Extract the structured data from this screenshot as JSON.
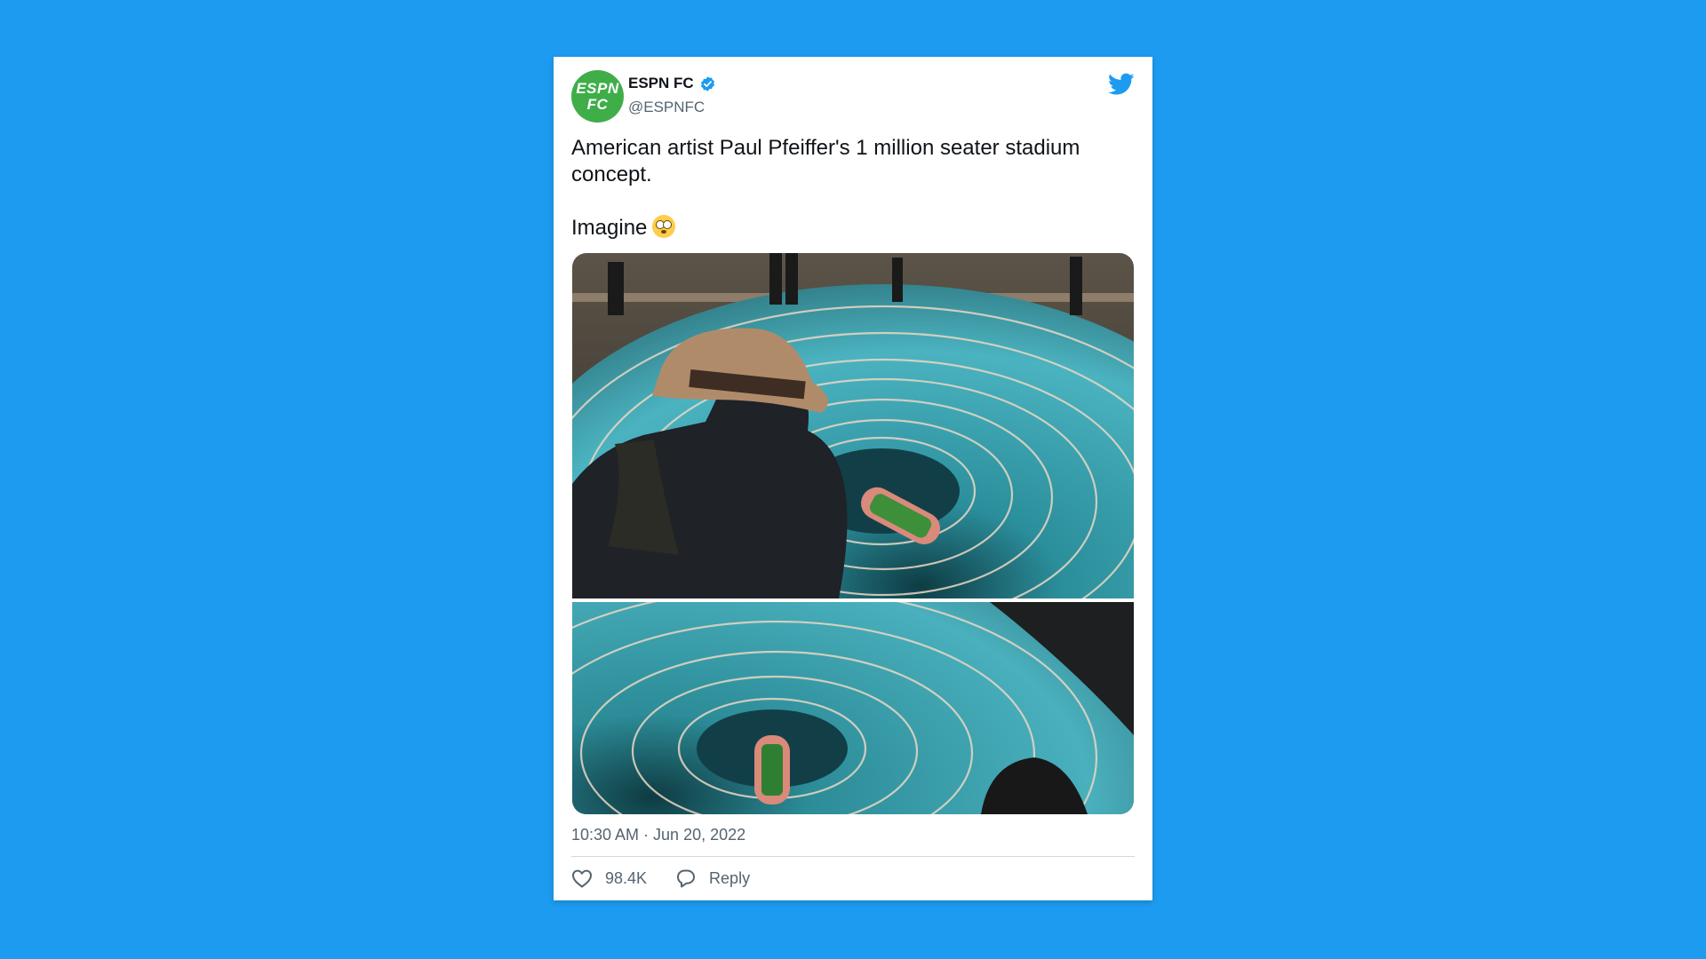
{
  "tweet": {
    "author": {
      "name": "ESPN FC",
      "handle": "@ESPNFC",
      "avatar_line1": "ESPN",
      "avatar_line2": "FC",
      "verified_icon": "verified-badge-icon"
    },
    "text_line1": "American artist Paul Pfeiffer's 1 million seater stadium concept.",
    "text_line2": "Imagine",
    "emoji": "flushed-face-emoji",
    "timestamp": "10:30 AM · Jun 20, 2022",
    "likes": "98.4K",
    "reply_label": "Reply"
  },
  "colors": {
    "background": "#1d9bf0",
    "card": "#ffffff",
    "avatar": "#3fae49",
    "twitter_blue": "#1d9bf0",
    "muted_text": "#536471",
    "stadium_seats": "#3aa5b5"
  },
  "icons": [
    "twitter-bird-icon",
    "verified-badge-icon",
    "heart-icon",
    "reply-bubble-icon"
  ]
}
